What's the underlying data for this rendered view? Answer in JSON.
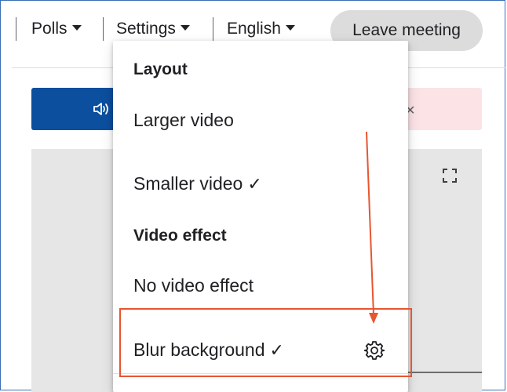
{
  "nav": {
    "polls_label": "Polls",
    "settings_label": "Settings",
    "language_label": "English",
    "leave_label": "Leave meeting"
  },
  "dropdown": {
    "layout_heading": "Layout",
    "larger_video": "Larger video",
    "smaller_video": "Smaller video",
    "video_effect_heading": "Video effect",
    "no_video_effect": "No video effect",
    "blur_background": "Blur background",
    "checkmark": "✓"
  },
  "icons": {
    "speaker": "speaker-icon",
    "close": "close-icon",
    "fullscreen": "fullscreen-icon",
    "gear": "gear-icon"
  },
  "colors": {
    "primary_blue": "#0b4f9e",
    "leave_button": "#dcdcdc",
    "alert_pink": "#fbe3e6",
    "annotation": "#e8552f"
  }
}
